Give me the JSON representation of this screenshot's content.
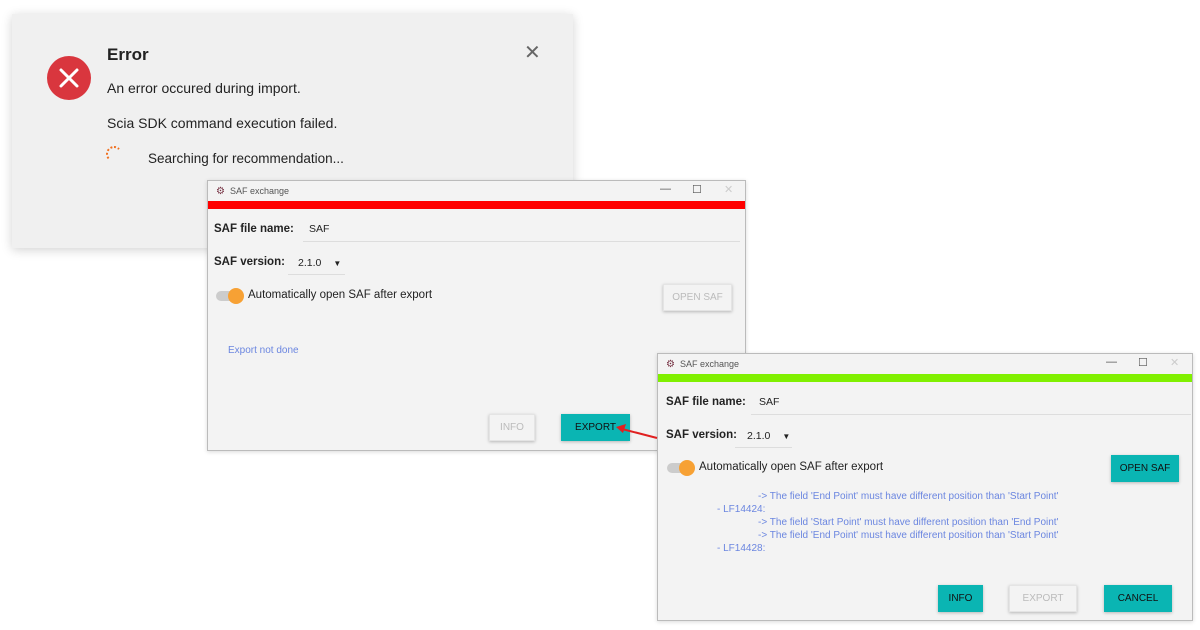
{
  "error_dialog": {
    "title": "Error",
    "line1": "An error occured during import.",
    "line2": "Scia SDK command execution failed.",
    "status": "Searching for recommendation...",
    "close": "✕"
  },
  "window1": {
    "title": "SAF exchange",
    "status_color": "#ff0000",
    "file_name_label": "SAF file name:",
    "file_name_value": "SAF",
    "version_label": "SAF version:",
    "version_value": "2.1.0",
    "toggle_label": "Automatically open SAF after export",
    "toggle_on": true,
    "open_saf": "OPEN SAF",
    "status_text": "Export not done",
    "info": "INFO",
    "export": "EXPORT"
  },
  "window2": {
    "title": "SAF exchange",
    "status_color": "#80f000",
    "file_name_label": "SAF file name:",
    "file_name_value": "SAF",
    "version_label": "SAF version:",
    "version_value": "2.1.0",
    "toggle_label": "Automatically open SAF after export",
    "toggle_on": true,
    "open_saf": "OPEN SAF",
    "log": [
      "-> The field 'End Point' must have different position than 'Start Point'",
      "- LF14424:",
      "-> The field 'Start Point' must have different position than 'End Point'",
      "-> The field 'End Point' must have different position than 'Start Point'",
      "- LF14428:"
    ],
    "info": "INFO",
    "export": "EXPORT",
    "cancel": "CANCEL"
  }
}
